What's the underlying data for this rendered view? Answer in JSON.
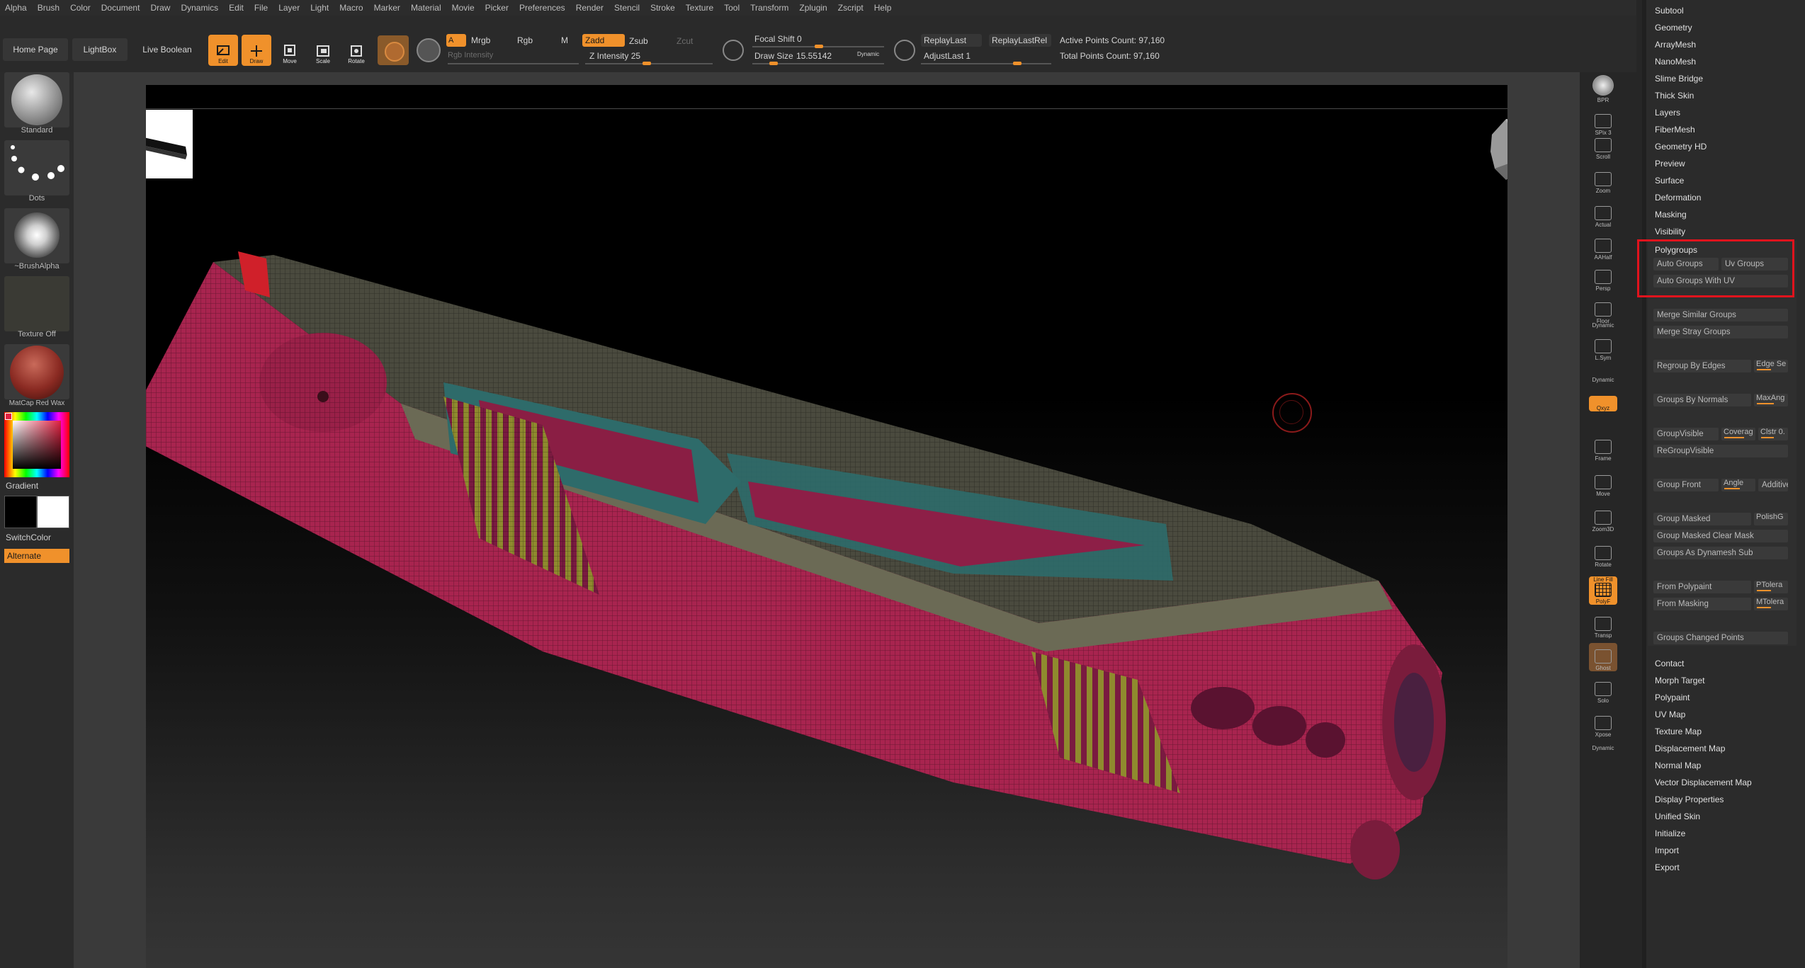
{
  "menu": [
    "Alpha",
    "Brush",
    "Color",
    "Document",
    "Draw",
    "Dynamics",
    "Edit",
    "File",
    "Layer",
    "Light",
    "Macro",
    "Marker",
    "Material",
    "Movie",
    "Picker",
    "Preferences",
    "Render",
    "Stencil",
    "Stroke",
    "Texture",
    "Tool",
    "Transform",
    "Zplugin",
    "Zscript",
    "Help"
  ],
  "toolbar": {
    "home_page": "Home Page",
    "lightbox": "LightBox",
    "live_boolean": "Live Boolean",
    "edit": "Edit",
    "draw": "Draw",
    "move": "Move",
    "scale": "Scale",
    "rotate": "Rotate",
    "a": "A",
    "mrgb": "Mrgb",
    "rgb": "Rgb",
    "m": "M",
    "rgb_intensity": "Rgb Intensity",
    "zadd": "Zadd",
    "zsub": "Zsub",
    "zcut": "Zcut",
    "z_intensity": "Z Intensity 25",
    "focal_shift": "Focal Shift 0",
    "draw_size_label": "Draw Size",
    "draw_size_value": "15.55142",
    "dynamic": "Dynamic",
    "replay_last": "ReplayLast",
    "replay_last_rel": "ReplayLastRel",
    "adjust_last": "AdjustLast 1",
    "active_points": "Active Points Count: 97,160",
    "total_points": "Total Points Count: 97,160"
  },
  "left_shelf": {
    "brush": "Standard",
    "stroke": "Dots",
    "alpha": "~BrushAlpha",
    "texture": "Texture Off",
    "material": "MatCap Red Wax",
    "gradient": "Gradient",
    "switch_color": "SwitchColor",
    "alternate": "Alternate"
  },
  "right_shelf": [
    {
      "name": "bpr",
      "label": "BPR"
    },
    {
      "name": "spix",
      "label": "SPix 3"
    },
    {
      "name": "scroll",
      "label": "Scroll"
    },
    {
      "name": "zoom",
      "label": "Zoom"
    },
    {
      "name": "actual",
      "label": "Actual"
    },
    {
      "name": "aahalf",
      "label": "AAHalf"
    },
    {
      "name": "persp",
      "label": "Persp"
    },
    {
      "name": "floor",
      "label": "Floor"
    },
    {
      "name": "lsym",
      "label": "L.Sym"
    },
    {
      "name": "xyz",
      "label": "Qxyz"
    },
    {
      "name": "frame",
      "label": "Frame"
    },
    {
      "name": "move",
      "label": "Move"
    },
    {
      "name": "zoom3d",
      "label": "Zoom3D"
    },
    {
      "name": "rotate",
      "label": "Rotate"
    },
    {
      "name": "polyf",
      "label": "PolyF"
    },
    {
      "name": "transp",
      "label": "Transp"
    },
    {
      "name": "ghost",
      "label": "Ghost"
    },
    {
      "name": "solo",
      "label": "Solo"
    },
    {
      "name": "xpose",
      "label": "Xpose"
    }
  ],
  "right_shelf_dynamic": "Dynamic",
  "line_fill_label": "Line Fill",
  "palette": {
    "top_items": [
      "Subtool",
      "Geometry",
      "ArrayMesh",
      "NanoMesh",
      "Slime Bridge",
      "Thick Skin",
      "Layers",
      "FiberMesh",
      "Geometry HD",
      "Preview",
      "Surface",
      "Deformation",
      "Masking",
      "Visibility"
    ],
    "polygroups_title": "Polygroups",
    "auto_groups": "Auto Groups",
    "uv_groups": "Uv Groups",
    "auto_groups_uv": "Auto Groups With UV",
    "merge_similar": "Merge Similar Groups",
    "merge_stray": "Merge Stray Groups",
    "regroup_edges": "Regroup By Edges",
    "edge_se": "Edge Se",
    "groups_normals": "Groups By Normals",
    "maxang": "MaxAng",
    "group_visible": "GroupVisible",
    "coverage": "Coverag",
    "clstr": "Clstr 0.",
    "regroup_visible": "ReGroupVisible",
    "group_front": "Group Front",
    "angle": "Angle",
    "additive": "Additive",
    "group_masked": "Group Masked",
    "polish": "PolishG",
    "group_masked_clear": "Group Masked Clear Mask",
    "group_dynamesh": "Groups As Dynamesh Sub",
    "from_polypaint": "From Polypaint",
    "ptolera": "PTolera",
    "from_masking": "From Masking",
    "mtolera": "MTolera",
    "groups_changed": "Groups Changed Points",
    "bottom_items": [
      "Contact",
      "Morph Target",
      "Polypaint",
      "UV Map",
      "Texture Map",
      "Displacement Map",
      "Normal Map",
      "Vector Displacement Map",
      "Display Properties",
      "Unified Skin",
      "Initialize",
      "Import",
      "Export"
    ]
  },
  "colors": {
    "accent": "#f0912b",
    "highlight": "#e0131d",
    "mesh_main": "#a8244f",
    "mesh_gray": "#5a5a4e",
    "mesh_teal": "#2e6b6a"
  }
}
